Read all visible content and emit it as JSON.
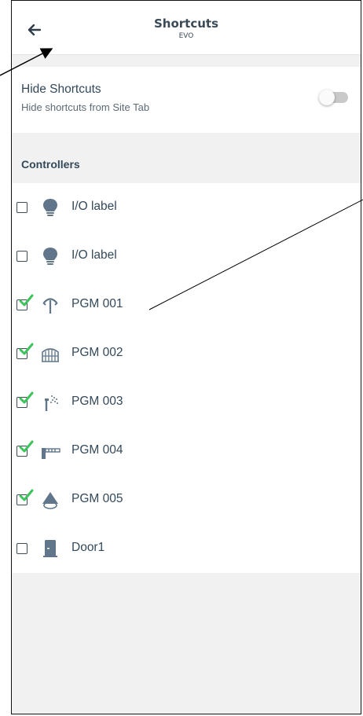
{
  "header": {
    "title": "Shortcuts",
    "subtitle": "EVO",
    "back_icon": "arrow-left-icon"
  },
  "settings": {
    "hide_title": "Hide Shortcuts",
    "hide_subtitle": "Hide shortcuts from Site Tab",
    "hide_enabled": false
  },
  "controllers": {
    "label": "Controllers",
    "items": [
      {
        "label": "I/O label",
        "checked": false,
        "icon": "lightbulb-icon"
      },
      {
        "label": "I/O label",
        "checked": false,
        "icon": "lightbulb-icon"
      },
      {
        "label": "PGM 001",
        "checked": true,
        "icon": "lawn-sprinkler-icon"
      },
      {
        "label": "PGM 002",
        "checked": true,
        "icon": "gate-icon"
      },
      {
        "label": "PGM 003",
        "checked": true,
        "icon": "water-spray-icon"
      },
      {
        "label": "PGM 004",
        "checked": true,
        "icon": "barrier-icon"
      },
      {
        "label": "PGM 005",
        "checked": true,
        "icon": "ceiling-lamp-icon"
      },
      {
        "label": "Door1",
        "checked": false,
        "icon": "door-icon"
      }
    ]
  },
  "colors": {
    "check_green": "#3cc35a",
    "icon_gray": "#61768a",
    "text": "#33495a",
    "background": "#f1f1f1"
  }
}
